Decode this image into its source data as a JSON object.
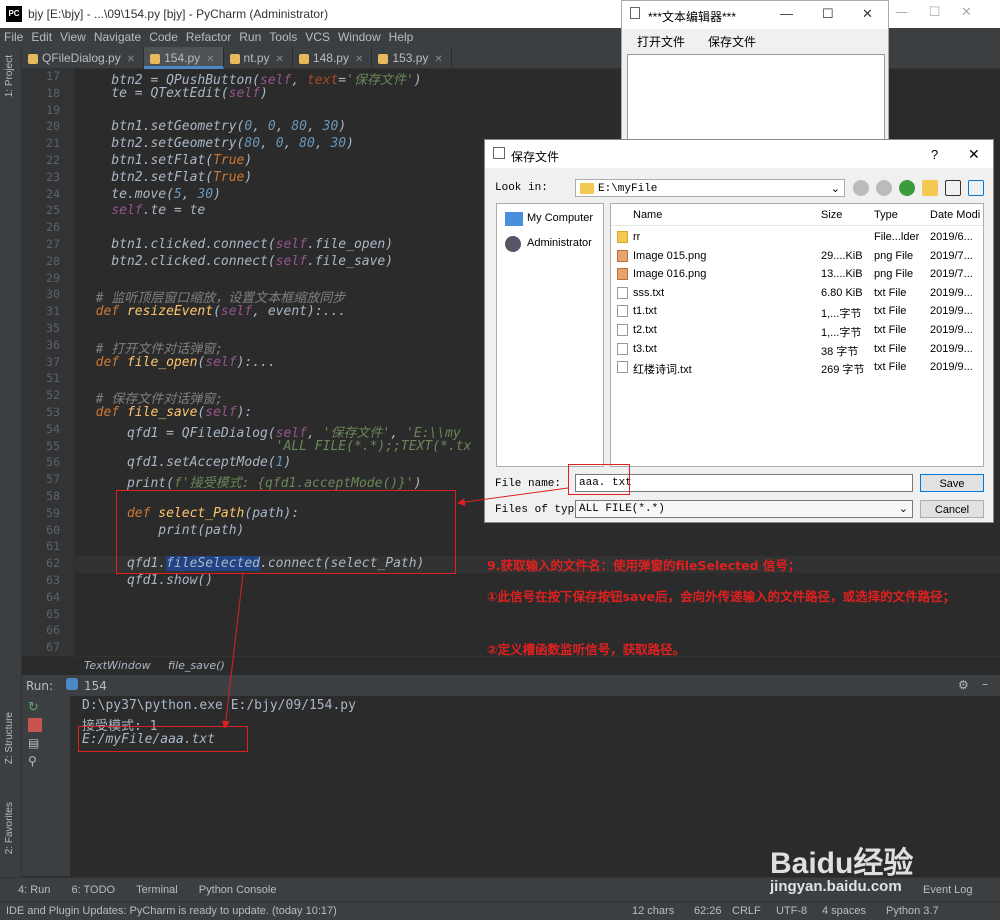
{
  "window": {
    "title": "bjy [E:\\bjy] - ...\\09\\154.py [bjy] - PyCharm (Administrator)"
  },
  "menu": [
    "File",
    "Edit",
    "View",
    "Navigate",
    "Code",
    "Refactor",
    "Run",
    "Tools",
    "VCS",
    "Window",
    "Help"
  ],
  "tabs": [
    {
      "label": "QFileDialog.py",
      "active": false
    },
    {
      "label": "154.py",
      "active": true
    },
    {
      "label": "nt.py",
      "active": false
    },
    {
      "label": "148.py",
      "active": false
    },
    {
      "label": "153.py",
      "active": false
    }
  ],
  "sidebar_labels": {
    "project": "1: Project",
    "structure": "Z: Structure",
    "favorites": "2: Favorites"
  },
  "gutter_lines": [
    "17",
    "18",
    "19",
    "20",
    "21",
    "22",
    "23",
    "24",
    "25",
    "26",
    "27",
    "28",
    "29",
    "30",
    "31",
    "35",
    "36",
    "37",
    "51",
    "52",
    "53",
    "54",
    "55",
    "56",
    "57",
    "58",
    "59",
    "60",
    "61",
    "62",
    "63",
    "64",
    "65",
    "66",
    "67"
  ],
  "breadcrumb": {
    "cls": "TextWindow",
    "method": "file_save()"
  },
  "run": {
    "label": "Run:",
    "tab": "154",
    "lines": [
      "D:\\py37\\python.exe E:/bjy/09/154.py",
      "接受模式: 1",
      "E:/myFile/aaa.txt"
    ]
  },
  "bottom_tabs": [
    "4: Run",
    "6: TODO",
    "Terminal",
    "Python Console"
  ],
  "event_log": "Event Log",
  "status": {
    "message": "IDE and Plugin Updates: PyCharm is ready to update. (today 10:17)",
    "chars": "12 chars",
    "pos": "62:26",
    "crlf": "CRLF",
    "enc": "UTF-8",
    "indent": "4 spaces",
    "python": "Python 3.7"
  },
  "text_editor": {
    "title": "***文本编辑器***",
    "open": "打开文件",
    "save": "保存文件"
  },
  "dialog": {
    "title": "保存文件",
    "help": "?",
    "look_in_label": "Look in:",
    "look_in": "E:\\myFile",
    "places": [
      "My Computer",
      "Administrator"
    ],
    "headers": [
      "Name",
      "Size",
      "Type",
      "Date Modi"
    ],
    "files": [
      {
        "name": "rr",
        "size": "",
        "type": "File...lder",
        "date": "2019/6...",
        "icon": "folder"
      },
      {
        "name": "Image 015.png",
        "size": "29....KiB",
        "type": "png File",
        "date": "2019/7...",
        "icon": "png"
      },
      {
        "name": "Image 016.png",
        "size": "13....KiB",
        "type": "png File",
        "date": "2019/7...",
        "icon": "png"
      },
      {
        "name": "sss.txt",
        "size": "6.80 KiB",
        "type": "txt File",
        "date": "2019/9...",
        "icon": "txt"
      },
      {
        "name": "t1.txt",
        "size": "1,...字节",
        "type": "txt File",
        "date": "2019/9...",
        "icon": "txt"
      },
      {
        "name": "t2.txt",
        "size": "1,...字节",
        "type": "txt File",
        "date": "2019/9...",
        "icon": "txt"
      },
      {
        "name": "t3.txt",
        "size": "38 字节",
        "type": "txt File",
        "date": "2019/9...",
        "icon": "txt"
      },
      {
        "name": "红楼诗词.txt",
        "size": "269 字节",
        "type": "txt File",
        "date": "2019/9...",
        "icon": "txt"
      }
    ],
    "file_name_label": "File name:",
    "file_name": "aaa. txt",
    "file_type_label": "Files of type:",
    "file_type": "ALL FILE(*.*)",
    "save": "Save",
    "cancel": "Cancel"
  },
  "annotations": {
    "a1": "9.获取输入的文件名：使用弹窗的fileSelected 信号；",
    "a2": "①此信号在按下保存按钮save后，会向外传递输入的文件路径，或选择的文件路径；",
    "a3": "②定义槽函数监听信号，获取路径。"
  },
  "watermark": {
    "brand": "Baidu经验",
    "url": "jingyan.baidu.com"
  },
  "colors": {
    "accent": "#4a88c7",
    "annotation": "#e02020",
    "editor_bg": "#2b2b2b"
  }
}
